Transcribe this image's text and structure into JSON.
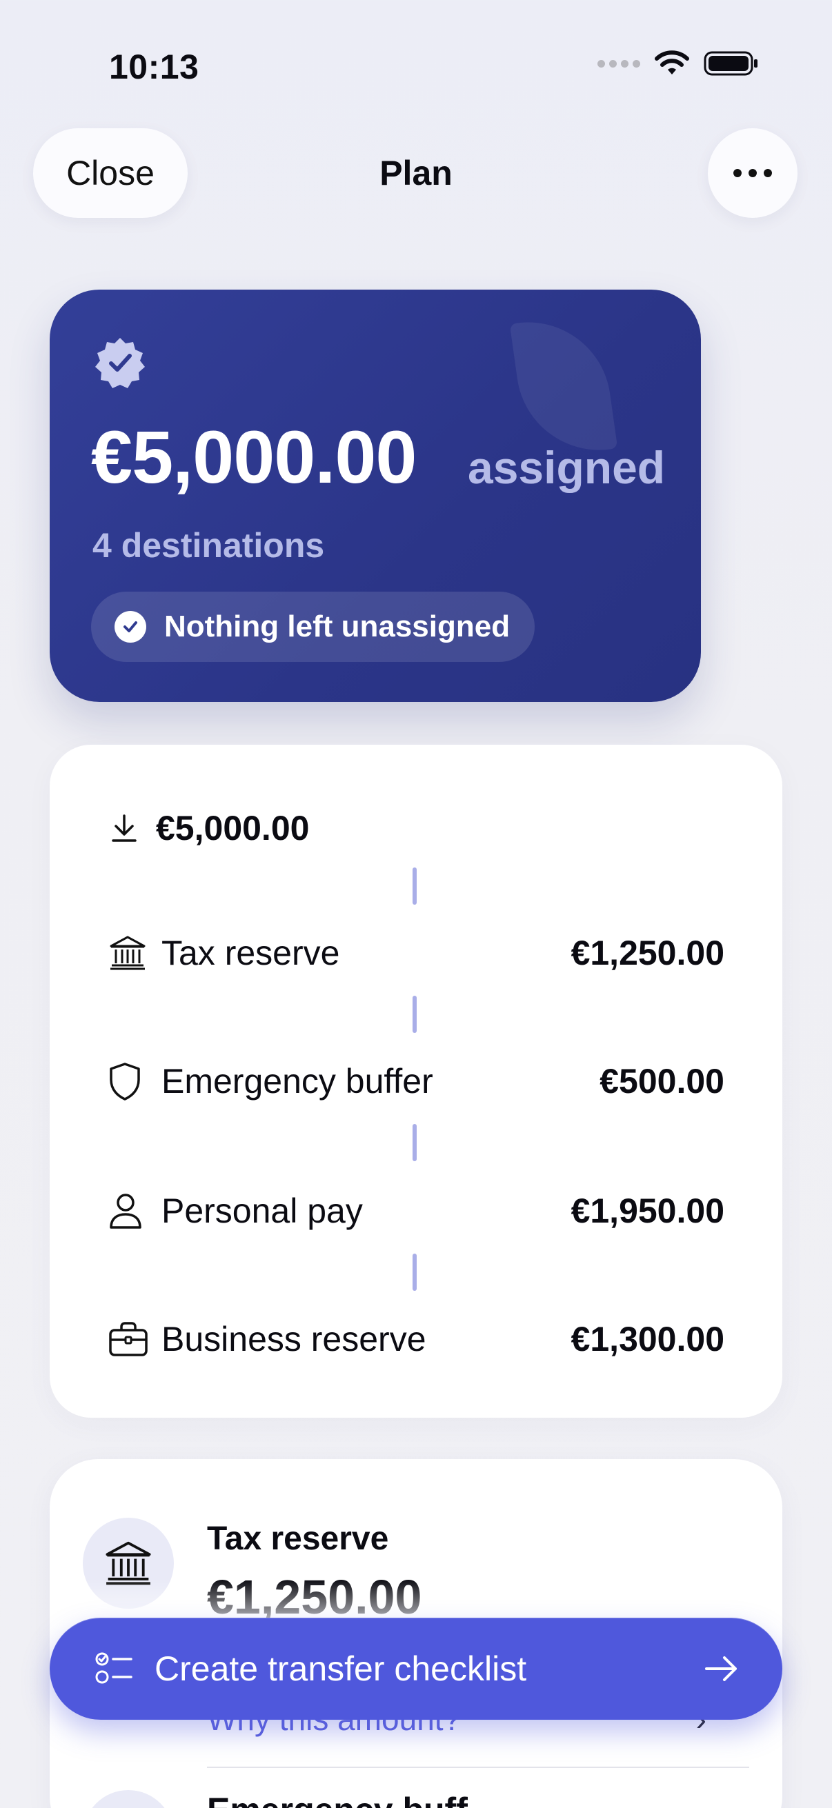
{
  "status_bar": {
    "time": "10:13"
  },
  "nav": {
    "close_label": "Close",
    "title": "Plan",
    "more_icon": "ellipsis-icon"
  },
  "hero": {
    "amount": "€5,000.00",
    "assigned_label": "assigned",
    "destinations": "4 destinations",
    "status_pill": "Nothing left unassigned",
    "colors": {
      "card": "#2f3a90",
      "muted_text": "#b5bbe8"
    }
  },
  "flow": {
    "source_amount": "€5,000.00",
    "source_icon": "download-arrow-icon",
    "items": [
      {
        "label": "Tax reserve",
        "amount": "€1,250.00",
        "icon": "bank-icon"
      },
      {
        "label": "Emergency buffer",
        "amount": "€500.00",
        "icon": "shield-icon"
      },
      {
        "label": "Personal pay",
        "amount": "€1,950.00",
        "icon": "person-icon"
      },
      {
        "label": "Business reserve",
        "amount": "€1,300.00",
        "icon": "briefcase-icon"
      }
    ],
    "connector_color": "#a9aee8"
  },
  "detail": {
    "label": "Tax reserve",
    "amount": "€1,250.00",
    "link": "Why this amount?",
    "next_label": "Emergency buff"
  },
  "cta": {
    "label": "Create transfer checklist",
    "color": "#4f58dc"
  }
}
